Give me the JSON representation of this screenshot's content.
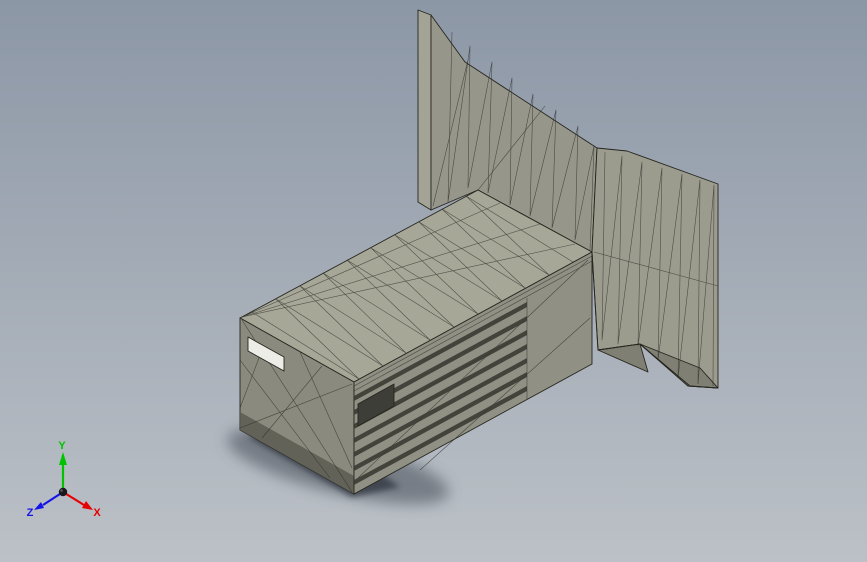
{
  "viewport": {
    "background": {
      "top": "#8C97A6",
      "bottom": "#BCC1C7"
    },
    "model": {
      "colors": {
        "top_face": "#A7A798",
        "left_face": "#8A8A7E",
        "right_face": "#909084",
        "fin_face": "#96968A",
        "fin_edge": "#A4A496",
        "wall_face": "#9B9B8E",
        "wall_facet": "#807F73",
        "louver": "#3B3B34",
        "hole_light": "#EDEDE7",
        "hole_dark": "#3E3E38",
        "mesh_line": "#2B2B26",
        "edge": "#26261F",
        "underside": "#5B5B52",
        "shadow": "#454B54",
        "shadow_core": "#383E46"
      }
    },
    "triad": {
      "x": {
        "label": "X",
        "color": "#E60000"
      },
      "y": {
        "label": "Y",
        "color": "#00C400"
      },
      "z": {
        "label": "Z",
        "color": "#1414E6"
      }
    }
  }
}
